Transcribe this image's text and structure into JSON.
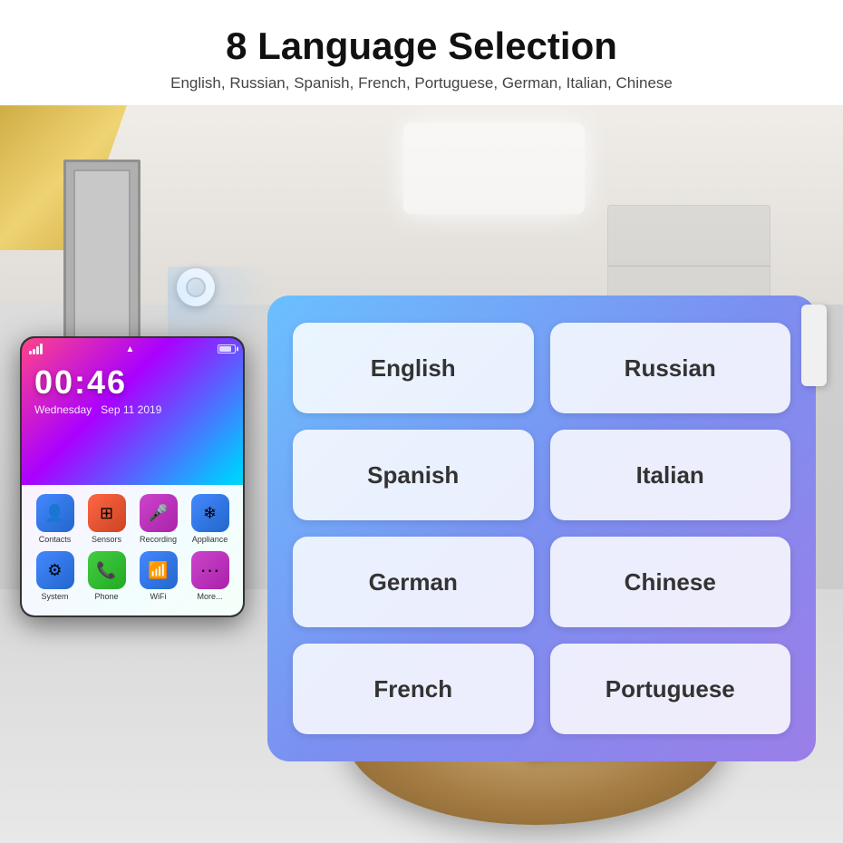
{
  "header": {
    "title": "8 Language Selection",
    "subtitle": "English, Russian, Spanish, French, Portuguese, German, Italian, Chinese"
  },
  "phone": {
    "time": "00:46",
    "day": "Wednesday",
    "date": "Sep 11 2019",
    "apps_row1": [
      {
        "label": "Contacts",
        "class": "app-contacts",
        "icon": "👤"
      },
      {
        "label": "Sensors",
        "class": "app-sensors",
        "icon": "⊞"
      },
      {
        "label": "Recording",
        "class": "app-recording",
        "icon": "🎤"
      },
      {
        "label": "Appliance",
        "class": "app-appliance",
        "icon": "❄"
      }
    ],
    "apps_row2": [
      {
        "label": "System",
        "class": "app-system",
        "icon": "⚙"
      },
      {
        "label": "Phone",
        "class": "app-phone",
        "icon": "📞"
      },
      {
        "label": "WiFi",
        "class": "app-wifi",
        "icon": "📶"
      },
      {
        "label": "More...",
        "class": "app-more",
        "icon": "···"
      }
    ]
  },
  "languages": [
    {
      "label": "English",
      "row": 1,
      "col": 1
    },
    {
      "label": "Russian",
      "row": 1,
      "col": 2
    },
    {
      "label": "Spanish",
      "row": 2,
      "col": 1
    },
    {
      "label": "Italian",
      "row": 2,
      "col": 2
    },
    {
      "label": "German",
      "row": 3,
      "col": 1
    },
    {
      "label": "Chinese",
      "row": 3,
      "col": 2
    },
    {
      "label": "French",
      "row": 4,
      "col": 1
    },
    {
      "label": "Portuguese",
      "row": 4,
      "col": 2
    }
  ]
}
